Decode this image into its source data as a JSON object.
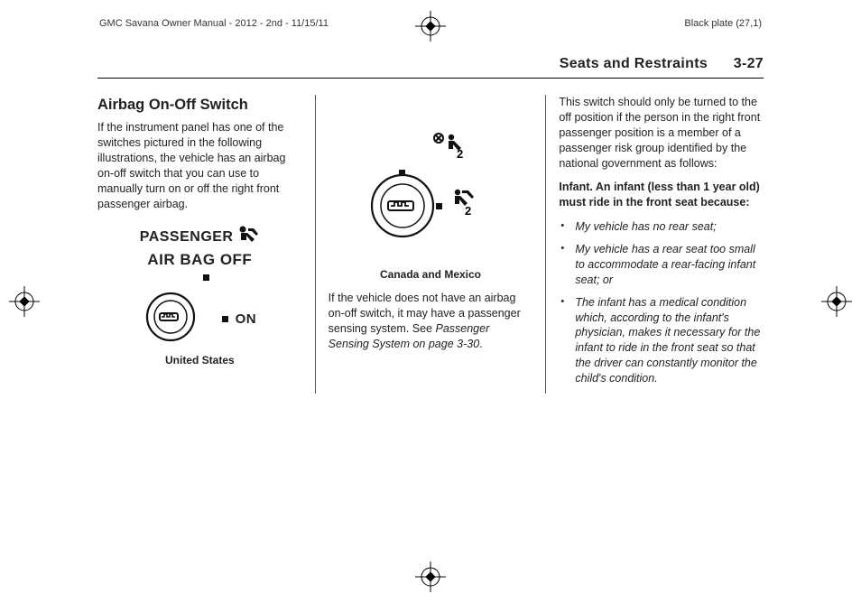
{
  "top": {
    "left": "GMC Savana Owner Manual - 2012 - 2nd - 11/15/11",
    "right": "Black plate (27,1)"
  },
  "header": {
    "section": "Seats and Restraints",
    "page": "3-27"
  },
  "col1": {
    "title": "Airbag On-Off Switch",
    "p1": "If the instrument panel has one of the switches pictured in the following illustrations, the vehicle has an airbag on-off switch that you can use to manually turn on or off the right front passenger airbag.",
    "label_passenger": "PASSENGER",
    "label_airbag_off": "AIR BAG OFF",
    "label_on": "ON",
    "caption": "United States"
  },
  "col2": {
    "caption": "Canada and Mexico",
    "p1_a": "If the vehicle does not have an airbag on-off switch, it may have a passenger sensing system. See ",
    "p1_b": "Passenger Sensing System on page 3-30",
    "p1_c": "."
  },
  "col3": {
    "p1": "This switch should only be turned to the off position if the person in the right front passenger position is a member of a passenger risk group identified by the national government as follows:",
    "boldline": "Infant.  An infant (less than 1 year old) must ride in the front seat because:",
    "b1": "My vehicle has no rear seat;",
    "b2": "My vehicle has a rear seat too small to accommodate a rear-facing infant seat; or",
    "b3": "The infant has a medical condition which, according to the infant's physician, makes it necessary for the infant to ride in the front seat so that the driver can constantly monitor the child's condition."
  }
}
